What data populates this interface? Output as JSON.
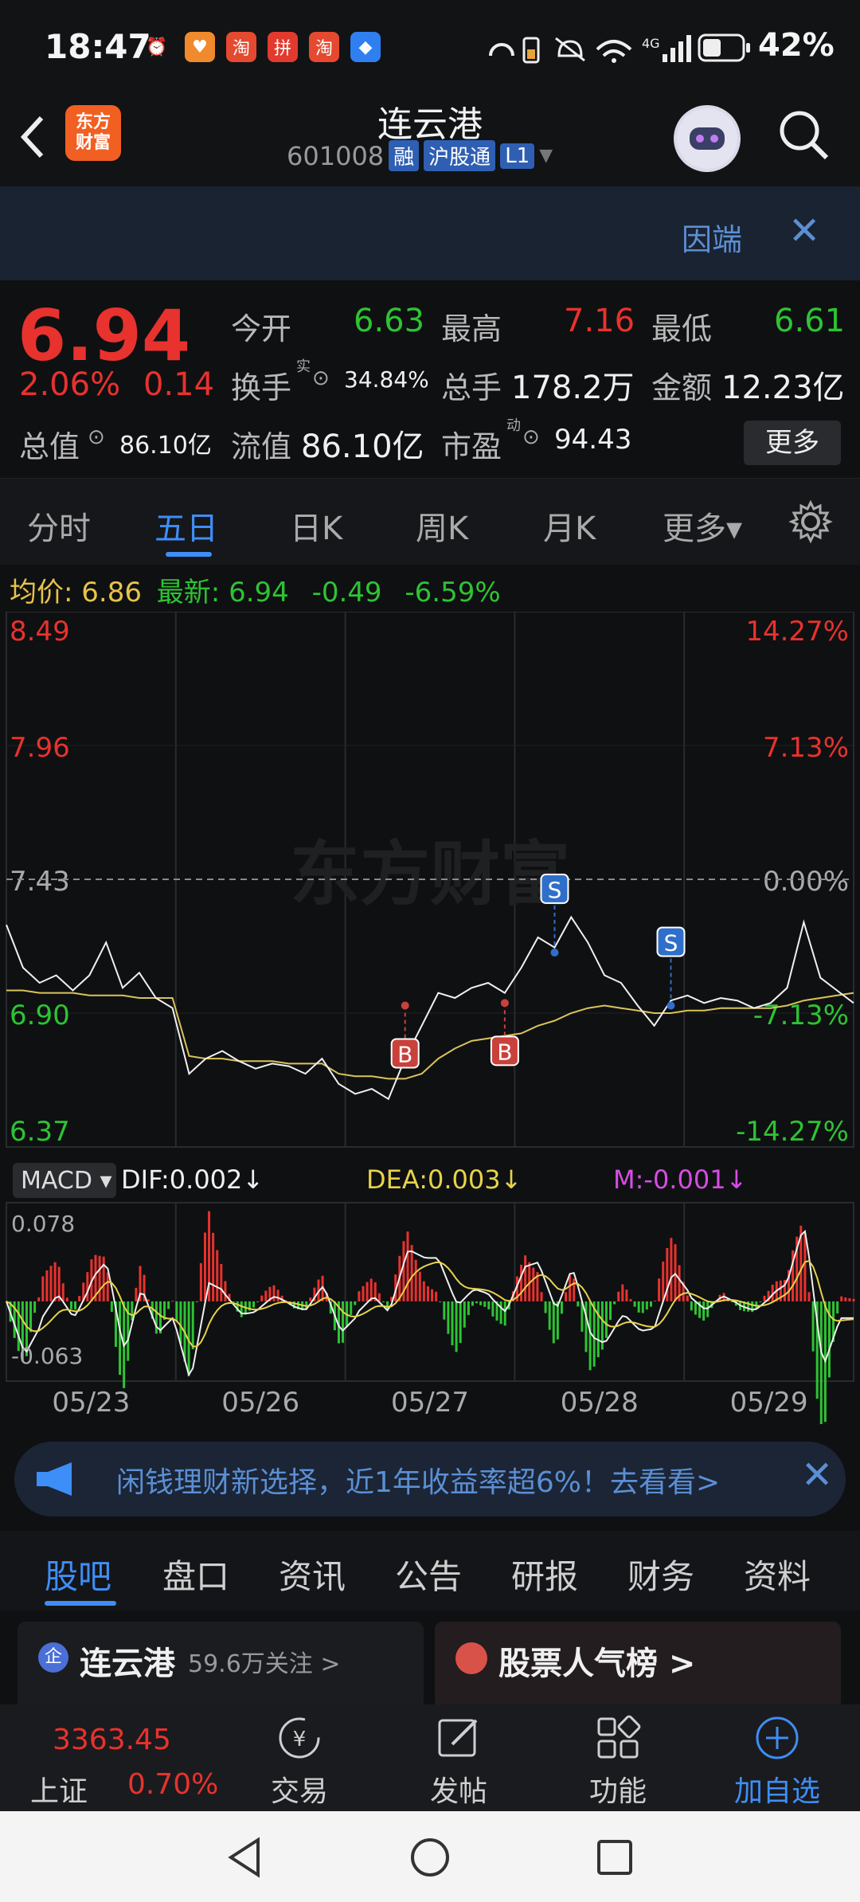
{
  "status": {
    "time": "18:47",
    "battery": "42%"
  },
  "header": {
    "title": "连云港",
    "code": "601008",
    "tag_margin": "融",
    "tag_connect": "沪股通",
    "tag_level": "L1",
    "logo_line1": "东方",
    "logo_line2": "财富"
  },
  "banner": {
    "text": "因端",
    "close": "✕"
  },
  "quote": {
    "price": "6.94",
    "change_pct": "2.06%",
    "change_abs": "0.14",
    "open_label": "今开",
    "open": "6.63",
    "high_label": "最高",
    "high": "7.16",
    "low_label": "最低",
    "low": "6.61",
    "turnover_label": "换手",
    "turnover_sup": "实",
    "turnover": "34.84%",
    "volume_label": "总手",
    "volume": "178.2万",
    "amount_label": "金额",
    "amount": "12.23亿",
    "mktcap_label": "总值",
    "mktcap": "86.10亿",
    "float_label": "流值",
    "float": "86.10亿",
    "pe_label": "市盈",
    "pe_sup": "动",
    "pe": "94.43",
    "more": "更多"
  },
  "period_tabs": [
    "分时",
    "五日",
    "日K",
    "周K",
    "月K",
    "更多▾"
  ],
  "info": {
    "avg_label": "均价:",
    "avg": "6.86",
    "latest_label": "最新:",
    "latest": "6.94",
    "chg": "-0.49",
    "chg_pct": "-6.59%"
  },
  "macd": {
    "selector": "MACD ▾",
    "dif": "DIF:0.002↓",
    "dea": "DEA:0.003↓",
    "m": "M:-0.001↓",
    "top": "0.078",
    "bottom": "-0.063"
  },
  "watermark": "东方财富",
  "chart_data": {
    "type": "line",
    "title": "",
    "y_left_ticks": [
      "8.49",
      "7.96",
      "7.43",
      "6.90",
      "6.37"
    ],
    "y_right_ticks": [
      "14.27%",
      "7.13%",
      "0.00%",
      "-7.13%",
      "-14.27%"
    ],
    "x_labels": [
      "05/23",
      "05/26",
      "05/27",
      "05/28",
      "05/29"
    ],
    "ylim": [
      6.37,
      8.49
    ],
    "prev_close": 7.43,
    "series": [
      {
        "values": [
          7.25,
          7.08,
          7.02,
          7.05,
          6.99,
          7.05,
          7.18,
          7.0,
          7.06,
          6.96,
          6.92,
          6.66,
          6.72,
          6.75,
          6.71,
          6.68,
          6.7,
          6.69,
          6.66,
          6.72,
          6.62,
          6.58,
          6.6,
          6.56,
          6.72,
          6.85,
          6.98,
          6.96,
          7.0,
          7.02,
          6.98,
          7.08,
          7.2,
          7.16,
          7.28,
          7.18,
          7.05,
          7.02,
          6.93,
          6.85,
          6.95,
          6.97,
          6.94,
          6.96,
          6.95,
          6.92,
          6.94,
          7.0,
          7.26,
          7.04,
          6.99,
          6.94
        ]
      },
      {
        "values": [
          6.99,
          6.99,
          6.98,
          6.98,
          6.98,
          6.97,
          6.97,
          6.97,
          6.96,
          6.96,
          6.96,
          6.73,
          6.72,
          6.72,
          6.71,
          6.71,
          6.71,
          6.7,
          6.7,
          6.7,
          6.66,
          6.65,
          6.65,
          6.64,
          6.64,
          6.66,
          6.72,
          6.76,
          6.79,
          6.8,
          6.81,
          6.82,
          6.85,
          6.87,
          6.9,
          6.92,
          6.93,
          6.92,
          6.91,
          6.9,
          6.9,
          6.91,
          6.91,
          6.92,
          6.92,
          6.92,
          6.92,
          6.93,
          6.95,
          6.96,
          6.97,
          6.98
        ]
      }
    ],
    "markers": [
      {
        "label": "B",
        "index": 24,
        "value": 6.93
      },
      {
        "label": "B",
        "index": 30,
        "value": 6.94
      },
      {
        "label": "S",
        "index": 33,
        "value": 7.14
      },
      {
        "label": "S",
        "index": 40,
        "value": 6.93
      }
    ],
    "macd_range": [
      -0.063,
      0.078
    ]
  },
  "ad": {
    "text": "闲钱理财新选择，近1年收益率超6%！去看看>",
    "close": "✕"
  },
  "content_tabs": [
    "股吧",
    "盘口",
    "资讯",
    "公告",
    "研报",
    "财务",
    "资料"
  ],
  "cards": {
    "left_title": "连云港",
    "left_sub": "59.6万关注 >",
    "right_title": "股票人气榜 >"
  },
  "bottom": {
    "index_name": "上证",
    "index_value": "3363.45",
    "index_chg": "0.70%",
    "trade": "交易",
    "post": "发帖",
    "func": "功能",
    "add": "加自选"
  }
}
